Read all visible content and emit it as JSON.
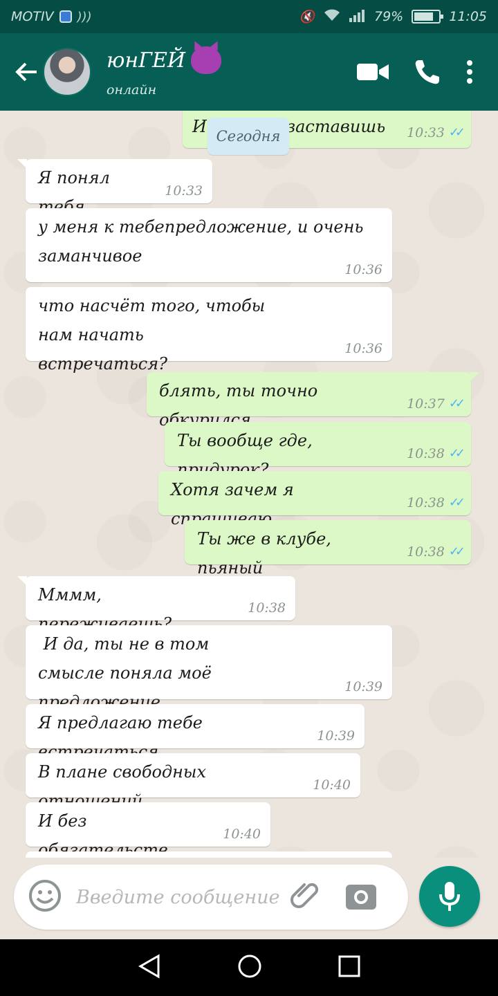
{
  "status_bar": {
    "carrier": "MOTIV",
    "battery": "79%",
    "battery_level": 0.79,
    "time": "11:05"
  },
  "header": {
    "contact_name": "юнГЕЙ",
    "status": "онлайн",
    "icons": [
      "back-arrow-icon",
      "avatar",
      "devil-emoji-icon",
      "video-call-icon",
      "phone-icon",
      "more-vert-icon"
    ]
  },
  "date_chip": "Сегодня",
  "partial_top": {
    "text_left": "И",
    "text_right": "заставишь",
    "time": "10:33"
  },
  "messages": [
    {
      "dir": "in",
      "text": "Я понял тебя",
      "time": "10:33"
    },
    {
      "dir": "in",
      "text": "у меня к тебепредложение, и очень заманчивое",
      "time": "10:36"
    },
    {
      "dir": "in",
      "text": "что насчёт того, чтобы нам начать встречаться?",
      "time": "10:36"
    },
    {
      "dir": "out",
      "text": "блять, ты точно обкурился",
      "time": "10:37"
    },
    {
      "dir": "out",
      "text": "Ты вообще где, придурок?",
      "time": "10:38"
    },
    {
      "dir": "out",
      "text": "Хотя зачем я спрашиваю",
      "time": "10:38"
    },
    {
      "dir": "out",
      "text": "Ты же в клубе, пьяный",
      "time": "10:38"
    },
    {
      "dir": "in",
      "text": "Мммм, переживаешь?",
      "time": "10:38"
    },
    {
      "dir": "in",
      "text": " И да, ты не в том смысле поняла моё предложение",
      "time": "10:39"
    },
    {
      "dir": "in",
      "text": "Я предлагаю тебе встречаться",
      "time": "10:39"
    },
    {
      "dir": "in",
      "text": "В плане свободных отношений",
      "time": "10:40"
    },
    {
      "dir": "in",
      "text": "И без обязательств",
      "time": "10:40"
    }
  ],
  "composer": {
    "placeholder": "Введите сообщение",
    "icons": [
      "emoji-icon",
      "attach-icon",
      "camera-icon",
      "mic-icon"
    ]
  },
  "nav_bar": {
    "icons": [
      "back-triangle-icon",
      "home-circle-icon",
      "recents-square-icon"
    ]
  },
  "colors": {
    "header": "#075e54",
    "status_bar": "#054d44",
    "outgoing_bubble": "#dcf8c6",
    "incoming_bubble": "#ffffff",
    "read_ticks": "#4fb6ec",
    "mic_button": "#0b8f7d",
    "chat_background": "#ece5dd"
  }
}
